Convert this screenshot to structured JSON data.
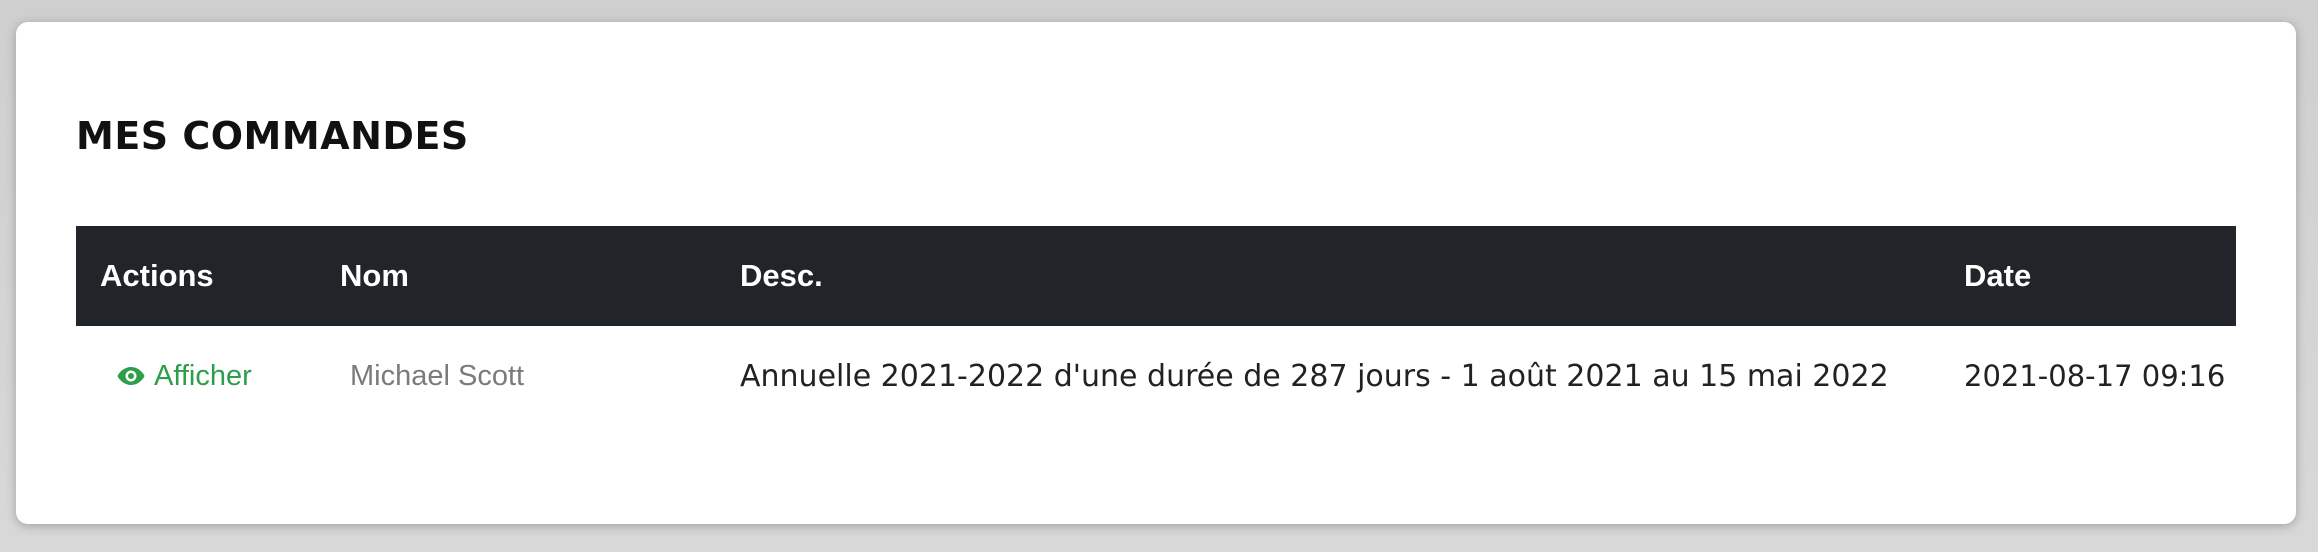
{
  "page": {
    "title": "MES COMMANDES"
  },
  "table": {
    "headers": {
      "actions": "Actions",
      "nom": "Nom",
      "desc": "Desc.",
      "date": "Date"
    },
    "rows": [
      {
        "action_label": "Afficher",
        "action_icon": "eye-icon",
        "nom": "Michael Scott",
        "desc": "Annuelle 2021-2022 d'une durée de 287 jours - 1 août 2021 au 15 mai 2022",
        "date": "2021-08-17 09:16"
      }
    ]
  },
  "colors": {
    "header_bg": "#212529",
    "header_text": "#ffffff",
    "action_link": "#2e9e4a",
    "nom_text": "#7b7b7b",
    "body_text": "#222222"
  }
}
